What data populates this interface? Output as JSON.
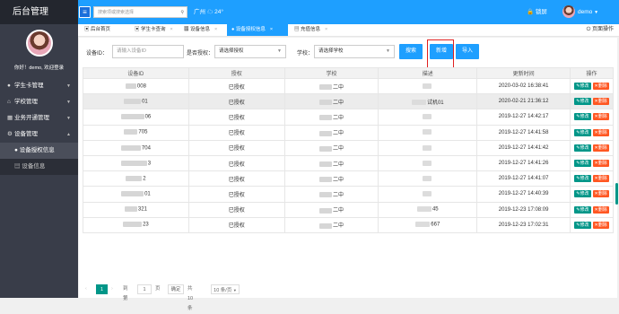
{
  "app": {
    "title": "后台管理"
  },
  "user": {
    "greeting": "你好！demo, 欢迎登录",
    "name": "demo",
    "lock": "锁屏"
  },
  "header": {
    "search_placeholder": "搜索项或搜索选择",
    "city": "广州",
    "temp": "24°",
    "weather_icon": "cloud-icon"
  },
  "sidebar": {
    "items": [
      {
        "label": "学生卡管理",
        "icon": "user-icon"
      },
      {
        "label": "学校管理",
        "icon": "home-icon"
      },
      {
        "label": "业务开通管理",
        "icon": "grid-icon"
      },
      {
        "label": "设备管理",
        "icon": "gear-icon"
      }
    ],
    "sub": [
      {
        "label": "设备授权信息"
      },
      {
        "label": "设备信息"
      }
    ]
  },
  "tabs": [
    {
      "label": "后台首页"
    },
    {
      "label": "学生卡查询"
    },
    {
      "label": "设备信息"
    },
    {
      "label": "设备授权信息"
    },
    {
      "label": "充值信息"
    }
  ],
  "page_close": "页面操作",
  "filter": {
    "device_label": "设备ID：",
    "device_placeholder": "请输入设备ID",
    "auth_label": "是否授权：",
    "auth_value": "请选择授权",
    "school_label": "学校：",
    "school_value": "请选择学校",
    "search": "搜索",
    "add": "新增",
    "import": "导入"
  },
  "table": {
    "headers": [
      "设备ID",
      "授权",
      "学校",
      "描述",
      "更新时间",
      "操作"
    ],
    "rows": [
      {
        "id": "008",
        "auth": "已授权",
        "school": "二中",
        "desc": "",
        "time": "2020-03-02 16:38:41"
      },
      {
        "id": "01",
        "auth": "已授权",
        "school": "二中",
        "desc": "试机01",
        "time": "2020-02-21 21:36:12"
      },
      {
        "id": "06",
        "auth": "已授权",
        "school": "二中",
        "desc": "",
        "time": "2019-12-27 14:42:17"
      },
      {
        "id": "705",
        "auth": "已授权",
        "school": "二中",
        "desc": "",
        "time": "2019-12-27 14:41:58"
      },
      {
        "id": "704",
        "auth": "已授权",
        "school": "二中",
        "desc": "",
        "time": "2019-12-27 14:41:42"
      },
      {
        "id": "3",
        "auth": "已授权",
        "school": "二中",
        "desc": "",
        "time": "2019-12-27 14:41:26"
      },
      {
        "id": "2",
        "auth": "已授权",
        "school": "二中",
        "desc": "",
        "time": "2019-12-27 14:41:07"
      },
      {
        "id": "01",
        "auth": "已授权",
        "school": "二中",
        "desc": "",
        "time": "2019-12-27 14:40:39"
      },
      {
        "id": "321",
        "auth": "已授权",
        "school": "二中",
        "desc": "45",
        "time": "2019-12-23 17:08:09"
      },
      {
        "id": "23",
        "auth": "已授权",
        "school": "二中",
        "desc": "667",
        "time": "2019-12-23 17:02:31"
      }
    ],
    "edit": "修改",
    "del": "删除"
  },
  "pager": {
    "current": "1",
    "goto": "到第",
    "page_input": "1",
    "page_unit": "页",
    "confirm": "确定",
    "total": "共 10 条",
    "per_page": "10 条/页"
  }
}
